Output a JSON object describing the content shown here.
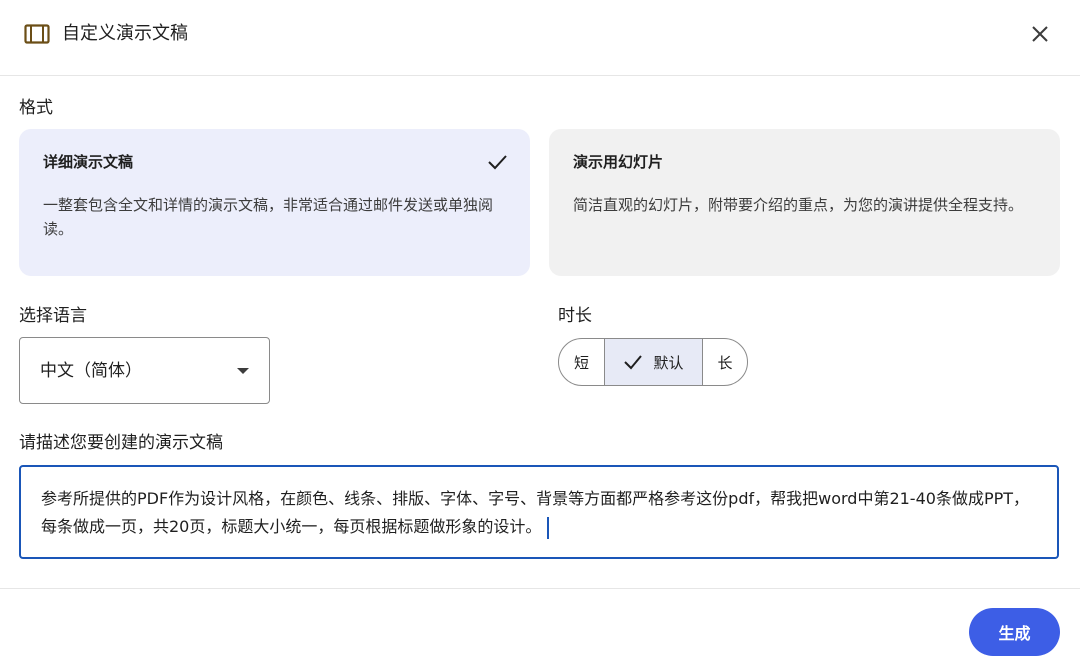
{
  "dialog": {
    "title": "自定义演示文稿",
    "close_icon": "close-icon",
    "title_icon": "slides-icon"
  },
  "format": {
    "label": "格式",
    "options": [
      {
        "title": "详细演示文稿",
        "description": "一整套包含全文和详情的演示文稿，非常适合通过邮件发送或单独阅读。",
        "selected": true
      },
      {
        "title": "演示用幻灯片",
        "description": "简洁直观的幻灯片，附带要介绍的重点，为您的演讲提供全程支持。",
        "selected": false
      }
    ]
  },
  "language": {
    "label": "选择语言",
    "value": "中文（简体）"
  },
  "duration": {
    "label": "时长",
    "options": [
      "短",
      "默认",
      "长"
    ],
    "selected": "默认"
  },
  "description": {
    "label": "请描述您要创建的演示文稿",
    "value": "参考所提供的PDF作为设计风格，在颜色、线条、排版、字体、字号、背景等方面都严格参考这份pdf，帮我把word中第21-40条做成PPT，每条做成一页，共20页，标题大小统一，每页根据标题做形象的设计。"
  },
  "actions": {
    "generate_label": "生成"
  },
  "colors": {
    "accent": "#3d5ee6",
    "selected_card": "#eceefb",
    "focus_border": "#1a56b8"
  }
}
